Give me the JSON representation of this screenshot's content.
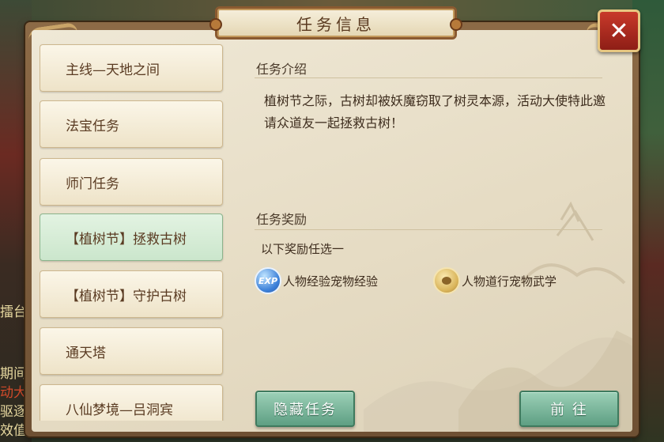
{
  "dialog": {
    "title": "任务信息",
    "close_glyph": "✕"
  },
  "quest_list": {
    "items": [
      {
        "label": "主线—天地之间",
        "active": false
      },
      {
        "label": "法宝任务",
        "active": false
      },
      {
        "label": "师门任务",
        "active": false
      },
      {
        "label": "【植树节】拯救古树",
        "active": true
      },
      {
        "label": "【植树节】守护古树",
        "active": false
      },
      {
        "label": "通天塔",
        "active": false
      },
      {
        "label": "八仙梦境—吕洞宾",
        "active": false
      }
    ]
  },
  "detail": {
    "intro_heading": "任务介绍",
    "intro_text": "植树节之际，古树却被妖魔窃取了树灵本源，活动大使特此邀请众道友一起拯救古树！",
    "reward_heading": "任务奖励",
    "reward_hint": "以下奖励任选一",
    "rewards": [
      {
        "icon": "exp-icon",
        "icon_text": "EXP",
        "label": "人物经验宠物经验"
      },
      {
        "icon": "coin-icon",
        "label": "人物道行宠物武学"
      }
    ]
  },
  "buttons": {
    "hide_label": "隐藏任务",
    "go_label": "前 往"
  },
  "background_hud": {
    "left_texts": [
      "擂台",
      "期间",
      "动大",
      "驱逐",
      "效值"
    ]
  },
  "colors": {
    "frame": "#8c6a46",
    "panel": "#efe8d6",
    "active_item": "#cbe6cc",
    "button": "#5e9f83",
    "close": "#c8392a"
  }
}
